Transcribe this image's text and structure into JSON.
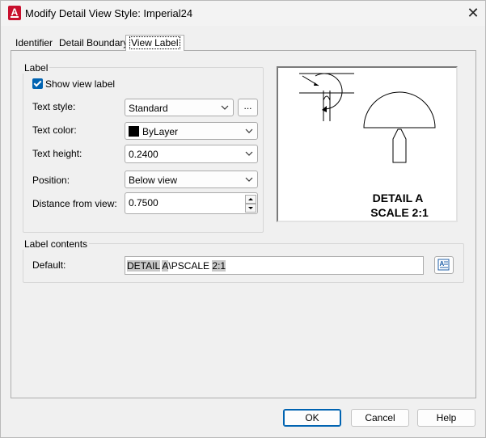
{
  "window": {
    "title": "Modify Detail View Style: Imperial24",
    "app_icon_letter": "A",
    "close_glyph": "✕"
  },
  "tabs": [
    {
      "label": "Identifier",
      "active": false
    },
    {
      "label": "Detail Boundary",
      "active": false
    },
    {
      "label": "View Label",
      "active": true
    }
  ],
  "label_group": {
    "title": "Label",
    "show_view_label": {
      "label": "Show view label",
      "checked": true
    },
    "text_style": {
      "label": "Text style:",
      "value": "Standard"
    },
    "text_style_button": "...",
    "text_color": {
      "label": "Text color:",
      "value": "ByLayer",
      "swatch": "#000000"
    },
    "text_height": {
      "label": "Text height:",
      "value": "0.2400"
    },
    "position": {
      "label": "Position:",
      "value": "Below view"
    },
    "distance_from_view": {
      "label": "Distance from view:",
      "value": "0.7500"
    }
  },
  "preview": {
    "line1": "DETAIL A",
    "line2": "SCALE 2:1"
  },
  "label_contents": {
    "title": "Label contents",
    "default": {
      "label": "Default:",
      "value_parts": [
        {
          "text": "DETAIL",
          "highlighted": true
        },
        {
          "text": " ",
          "highlighted": false
        },
        {
          "text": "A",
          "highlighted": true
        },
        {
          "text": "\\PSCALE ",
          "highlighted": false
        },
        {
          "text": "2:1",
          "highlighted": true
        }
      ]
    }
  },
  "buttons": {
    "ok": "OK",
    "cancel": "Cancel",
    "help": "Help"
  },
  "colors": {
    "accent": "#0063b1",
    "app_icon": "#c8102e",
    "field_highlight": "#c8c8c8"
  }
}
